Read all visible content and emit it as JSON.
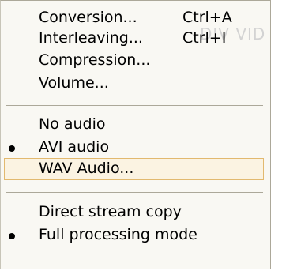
{
  "menu": {
    "items": [
      {
        "label": "Conversion...",
        "shortcut": "Ctrl+A"
      },
      {
        "label": "Interleaving...",
        "shortcut": "Ctrl+I"
      },
      {
        "label": "Compression..."
      },
      {
        "label": "Volume..."
      },
      {
        "label": "No audio"
      },
      {
        "label": "AVI audio",
        "selected": true
      },
      {
        "label": "WAV Audio...",
        "highlighted": true
      },
      {
        "label": "Direct stream copy"
      },
      {
        "label": "Full processing mode",
        "selected": true
      }
    ]
  },
  "watermark": {
    "text": "DIV VID"
  },
  "colors": {
    "menu_background": "#f9f8f3",
    "highlight_background": "#fbf3e2",
    "highlight_border": "#e2b96f",
    "separator": "#aca899"
  },
  "icons": {
    "selected_marker": "radio-bullet-icon"
  }
}
